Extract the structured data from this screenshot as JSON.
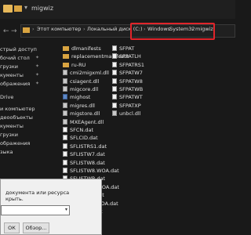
{
  "window": {
    "title": "migwiz"
  },
  "address": {
    "segments": [
      "Этот компьютер",
      "Локальный диск (C:)",
      "Windows",
      "System32",
      "migwiz"
    ],
    "separator": "›"
  },
  "sidebar": {
    "items": [
      "стрый доступ",
      "бочий стол",
      "грузки",
      "кументы",
      "ображения",
      "Drive",
      "и компьютер",
      "деообъекты",
      "кументы",
      "грузки",
      "ображения",
      "зыка"
    ]
  },
  "files": {
    "column1": [
      {
        "name": "dlmanifests",
        "type": "folder"
      },
      {
        "name": "replacementmanifests",
        "type": "folder"
      },
      {
        "name": "ru-RU",
        "type": "folder"
      },
      {
        "name": "cmi2migxml.dll",
        "type": "dll"
      },
      {
        "name": "csiagent.dll",
        "type": "dll"
      },
      {
        "name": "migcore.dll",
        "type": "dll"
      },
      {
        "name": "mighost",
        "type": "exe"
      },
      {
        "name": "migres.dll",
        "type": "dll"
      },
      {
        "name": "migstore.dll",
        "type": "dll"
      },
      {
        "name": "MXEAgent.dll",
        "type": "dll"
      },
      {
        "name": "SFCN.dat",
        "type": "dat"
      },
      {
        "name": "SFLCID.dat",
        "type": "dat"
      },
      {
        "name": "SFLISTRS1.dat",
        "type": "dat"
      },
      {
        "name": "SFLISTW7.dat",
        "type": "dat"
      },
      {
        "name": "SFLISTW8.dat",
        "type": "dat"
      },
      {
        "name": "SFLISTW8.WOA.dat",
        "type": "dat"
      },
      {
        "name": "SFLISTWB.dat",
        "type": "dat"
      },
      {
        "name": "SFLISTWB.WOA.dat",
        "type": "dat"
      },
      {
        "name": "SFLISTWT.dat",
        "type": "dat"
      },
      {
        "name": "SFLISTWT.WOA.dat",
        "type": "dat"
      },
      {
        "name": "SFLISTXP.dat",
        "type": "dat"
      }
    ],
    "column2": [
      {
        "name": "SFPAT",
        "type": "dat"
      },
      {
        "name": "SFPATLH",
        "type": "dat"
      },
      {
        "name": "SFPATRS1",
        "type": "dat"
      },
      {
        "name": "SFPATW7",
        "type": "dat"
      },
      {
        "name": "SFPATW8",
        "type": "dat"
      },
      {
        "name": "SFPATWB",
        "type": "dat"
      },
      {
        "name": "SFPATWT",
        "type": "dat"
      },
      {
        "name": "SFPATXP",
        "type": "dat"
      },
      {
        "name": "unbcl.dll",
        "type": "dll"
      }
    ]
  },
  "run_dialog": {
    "line1": "документа или ресурса",
    "line2": "крыть.",
    "browse_label": "Обзор...",
    "ok_label": "ОК"
  }
}
